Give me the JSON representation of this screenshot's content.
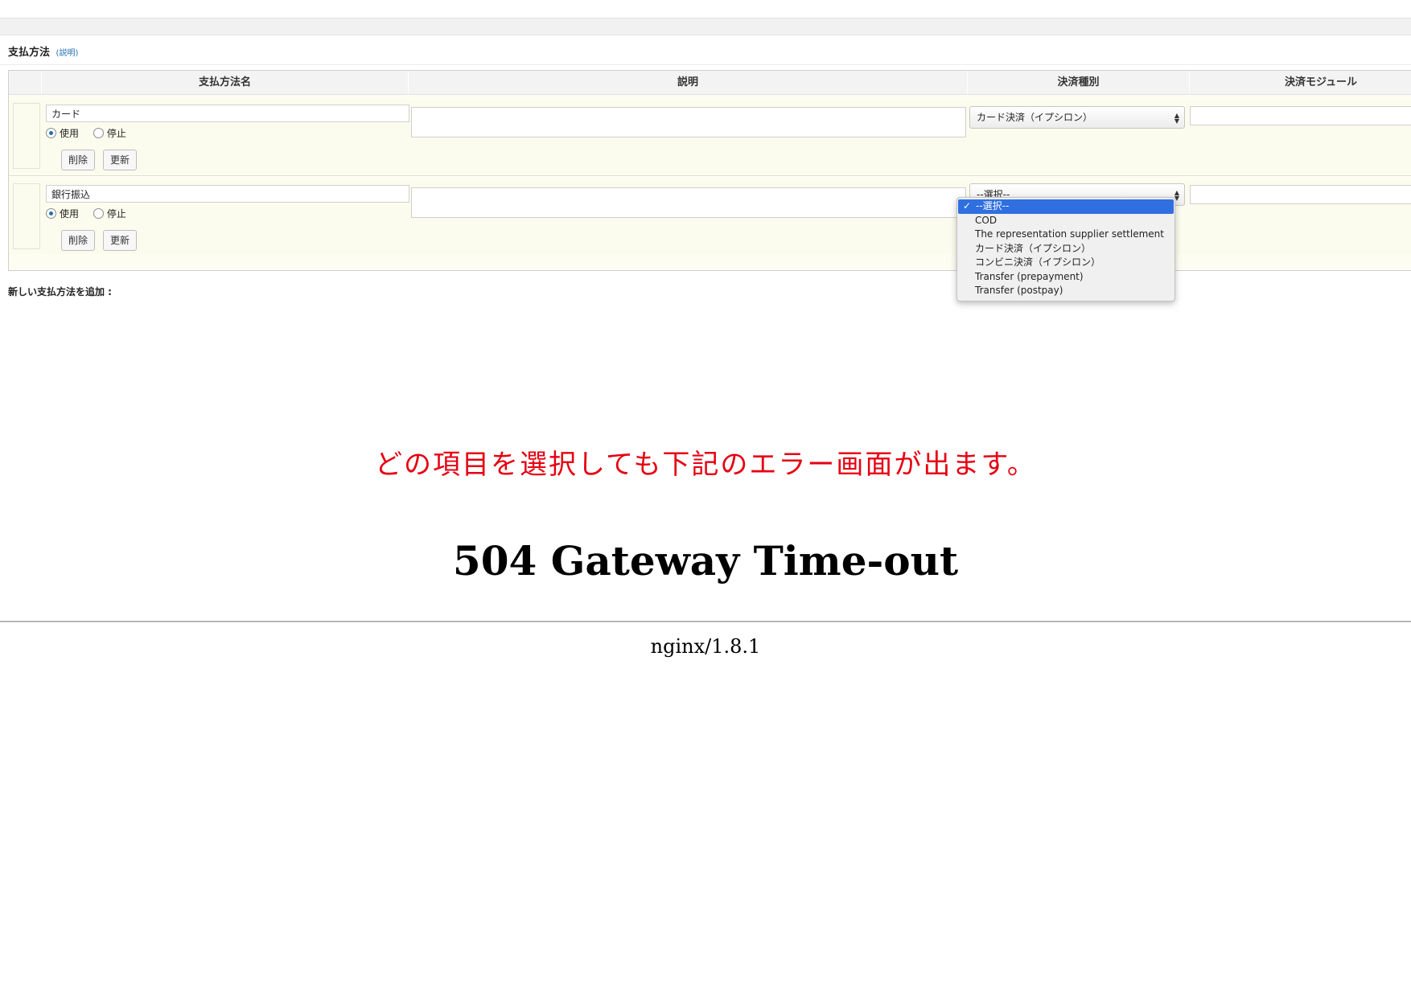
{
  "section": {
    "title": "支払方法",
    "help_link": "(説明)"
  },
  "table": {
    "headers": [
      "支払方法名",
      "説明",
      "決済種別",
      "決済モジュール"
    ]
  },
  "rows": [
    {
      "name": "カード",
      "radio_use": "使用",
      "radio_stop": "停止",
      "selected_status": "使用",
      "delete_label": "削除",
      "update_label": "更新",
      "description": "",
      "payment_type": "カード決済（イプシロン）",
      "module": ""
    },
    {
      "name": "銀行振込",
      "radio_use": "使用",
      "radio_stop": "停止",
      "selected_status": "使用",
      "delete_label": "削除",
      "update_label": "更新",
      "description": "",
      "payment_type": "--選択--",
      "module": ""
    }
  ],
  "dropdown": {
    "options": [
      "--選択--",
      "COD",
      "The representation supplier settlement",
      "カード決済（イプシロン）",
      "コンビニ決済（イプシロン）",
      "Transfer (prepayment)",
      "Transfer (postpay)"
    ],
    "selected_index": 0,
    "check_glyph": "✓"
  },
  "add_new_label": "新しい支払方法を追加 :",
  "notice": "どの項目を選択しても下記のエラー画面が出ます。",
  "error": {
    "title": "504 Gateway Time-out",
    "server": "nginx/1.8.1"
  },
  "colors": {
    "notice": "#e60012",
    "link": "#2271b1",
    "dropdown_selected": "#2f6fe0"
  }
}
